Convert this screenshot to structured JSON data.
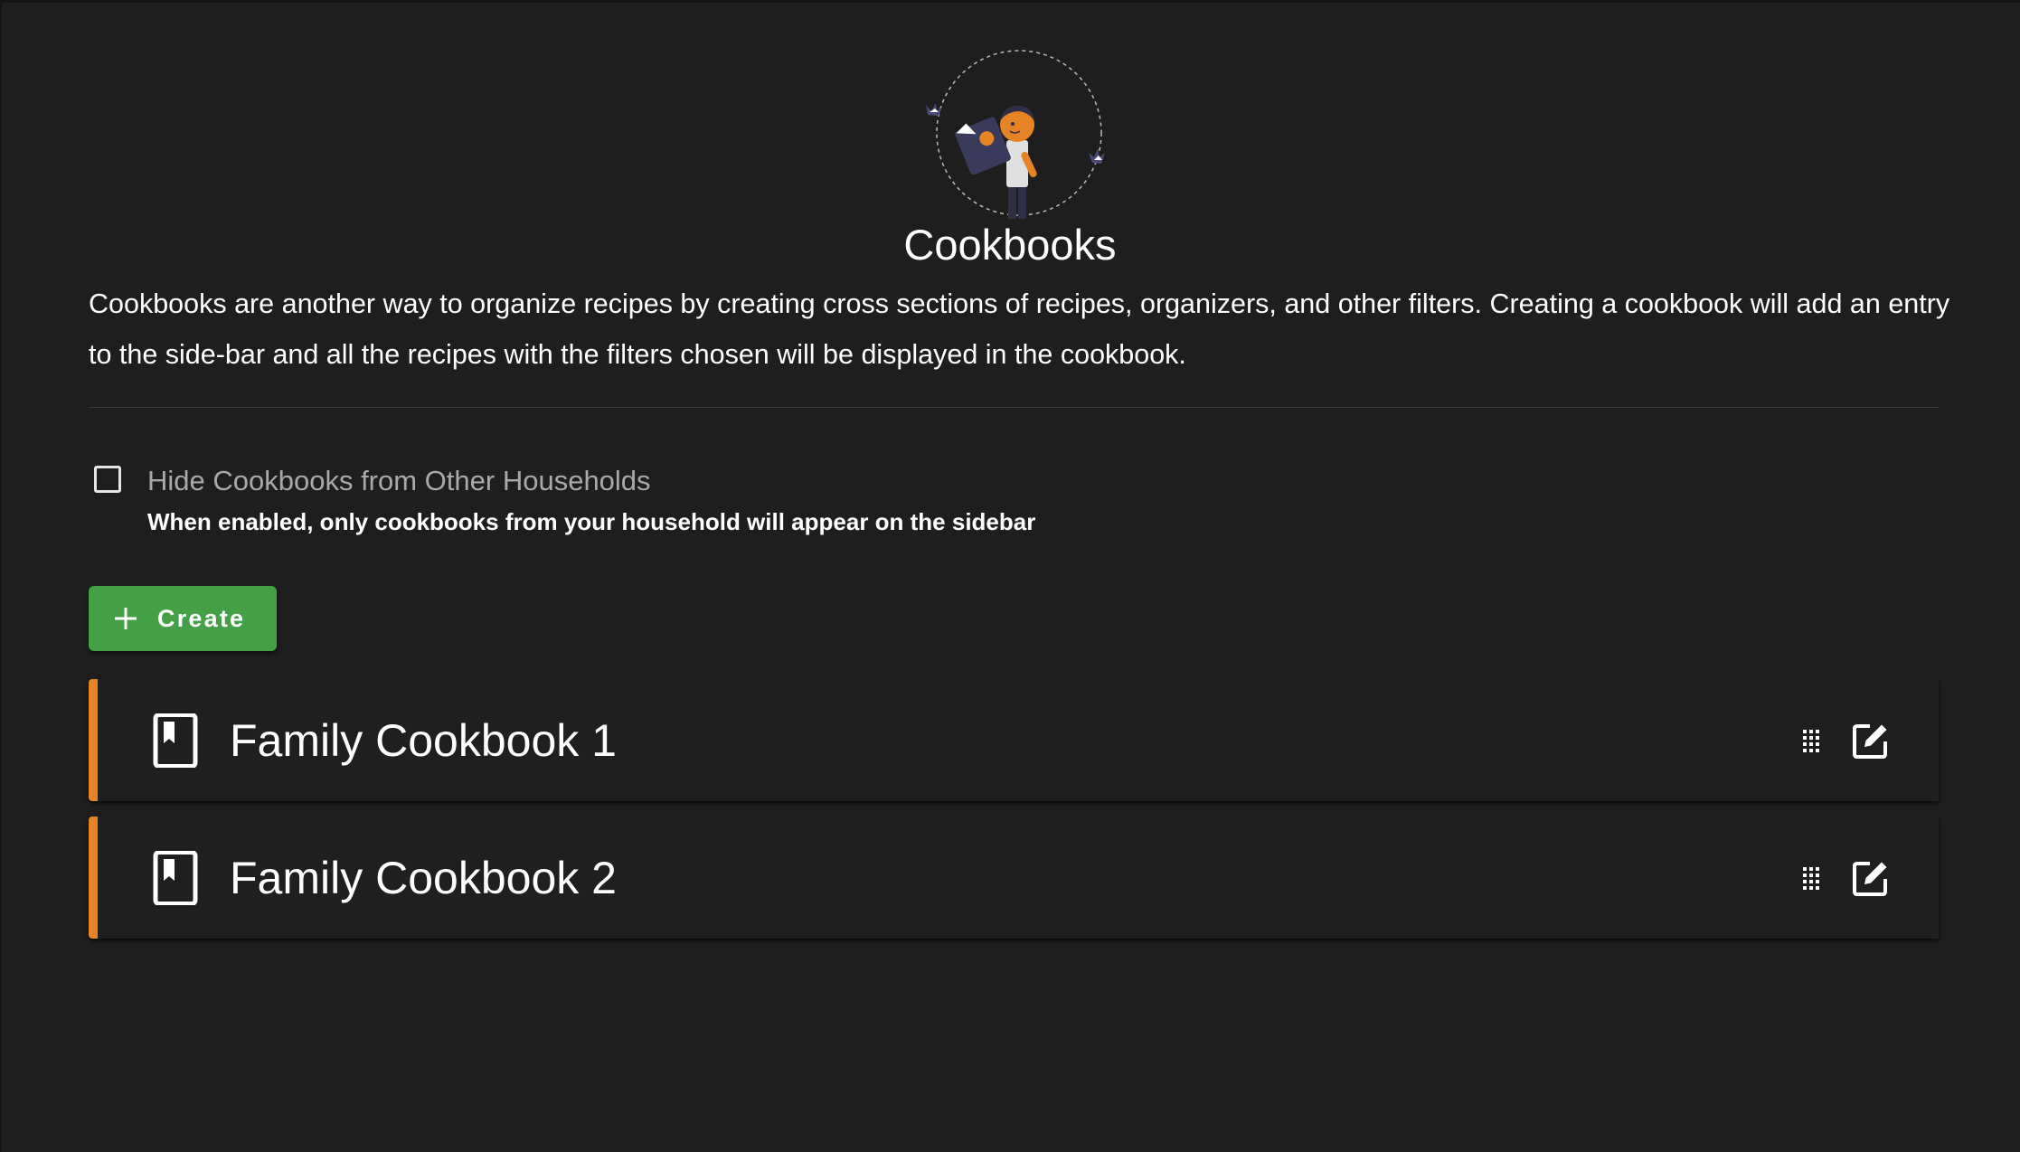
{
  "page": {
    "title": "Cookbooks",
    "description": "Cookbooks are another way to organize recipes by creating cross sections of recipes, organizers, and other filters. Creating a cookbook will add an entry to the side-bar and all the recipes with the filters chosen will be displayed in the cookbook."
  },
  "filter": {
    "label": "Hide Cookbooks from Other Households",
    "hint": "When enabled, only cookbooks from your household will appear on the sidebar",
    "checked": false
  },
  "toolbar": {
    "create_label": "Create",
    "create_icon": "plus-icon"
  },
  "cookbooks": [
    {
      "name": "Family Cookbook 1",
      "icon": "bookmark-book-icon"
    },
    {
      "name": "Family Cookbook 2",
      "icon": "bookmark-book-icon"
    }
  ],
  "colors": {
    "background": "#1e1e1e",
    "accent": "#e58325",
    "create_button": "#43a047",
    "text": "#ffffff",
    "muted_text": "#a9a9a9"
  }
}
